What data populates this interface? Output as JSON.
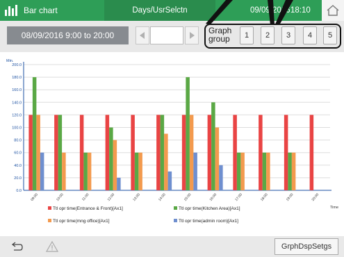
{
  "titlebar": {
    "app_title": "Bar chart",
    "mode": "Days/UsrSelctn",
    "date": "09/09/2016",
    "time": "18:10",
    "home_icon": "home-icon",
    "app_icon": "bar-chart-icon"
  },
  "toolbar": {
    "period": "08/09/2016 9:00 to 20:00",
    "prev_icon": "arrow-left-icon",
    "next_icon": "arrow-right-icon",
    "period_field_value": "",
    "graph_group_label": [
      "Graph",
      "group"
    ],
    "groups": [
      "1",
      "2",
      "3",
      "4",
      "5"
    ],
    "selected_group": "2"
  },
  "bottombar": {
    "back_icon": "return-icon",
    "alarm_icon": "warning-icon",
    "settings_label": "GrphDspSetgs"
  },
  "colors": {
    "titlebar": "#2e9e57",
    "red": "#e94444",
    "green": "#5aa845",
    "orange": "#f39a4e",
    "blue": "#6f8fcf"
  },
  "chart_data": {
    "type": "bar",
    "ylabel": "Min.",
    "xlabel": "Time",
    "ylim": [
      0,
      200
    ],
    "yticks": [
      "0.0",
      "20.0",
      "40.0",
      "60.0",
      "80.0",
      "100.0",
      "120.0",
      "140.0",
      "160.0",
      "180.0",
      "200.0"
    ],
    "categories": [
      "09:00",
      "10:00",
      "11:00",
      "12:00",
      "13:00",
      "14:00",
      "15:00",
      "16:00",
      "17:00",
      "18:00",
      "19:00",
      "20:00"
    ],
    "series": [
      {
        "name": "Ttl opr time(Entrance & Front)[Ax1]",
        "color": "#e94444",
        "values": [
          120,
          120,
          120,
          120,
          120,
          120,
          120,
          120,
          120,
          120,
          120,
          120
        ]
      },
      {
        "name": "Ttl opr time(Kitchen Area)[Ax1]",
        "color": "#5aa845",
        "values": [
          180,
          120,
          60,
          100,
          60,
          120,
          180,
          140,
          60,
          60,
          60,
          0
        ]
      },
      {
        "name": "Ttl opr time(mng office)[Ax1]",
        "color": "#f39a4e",
        "values": [
          120,
          60,
          60,
          80,
          60,
          90,
          120,
          100,
          60,
          60,
          60,
          0
        ]
      },
      {
        "name": "Ttl opr time(admin room)[Ax1]",
        "color": "#6f8fcf",
        "values": [
          60,
          0,
          0,
          20,
          0,
          30,
          60,
          40,
          0,
          0,
          0,
          0
        ]
      }
    ],
    "grid": true,
    "legend_position": "bottom"
  }
}
